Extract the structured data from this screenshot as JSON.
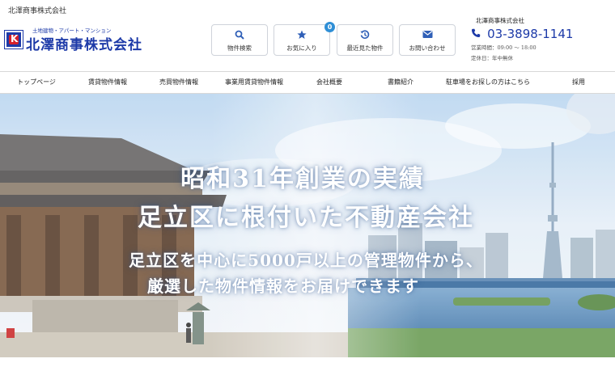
{
  "top_company": "北澤商事株式会社",
  "logo": {
    "subtitle": "土地建物・アパート・マンション",
    "name": "北澤商事株式会社"
  },
  "quick_buttons": [
    {
      "label": "物件検索",
      "icon": "search-icon"
    },
    {
      "label": "お気に入り",
      "icon": "star-icon",
      "badge": "0"
    },
    {
      "label": "最近見た物件",
      "icon": "history-icon"
    },
    {
      "label": "お問い合わせ",
      "icon": "mail-icon"
    }
  ],
  "contact": {
    "company": "北澤商事株式会社",
    "phone": "03-3898-1141",
    "hours": "営業時間：09:00 〜 18:00",
    "closed": "定休日：年中無休"
  },
  "nav": [
    "トップページ",
    "賃貸物件情報",
    "売買物件情報",
    "事業用賃貸物件情報",
    "会社概要",
    "書籍紹介",
    "駐車場をお探しの方はこちら",
    "採用"
  ],
  "hero": {
    "line1": "昭和31年創業の実績",
    "line2": "足立区に根付いた不動産会社",
    "line3": "足立区を中心に5000戸以上の管理物件から、",
    "line4": "厳選した物件情報をお届けできます"
  },
  "colors": {
    "brand": "#1d3aa8",
    "accent": "#2f5fb7",
    "badge": "#2f8fd6"
  }
}
